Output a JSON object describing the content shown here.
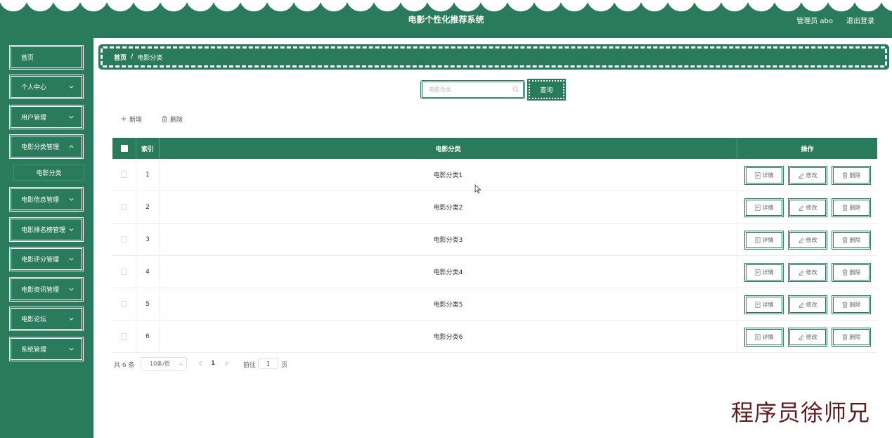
{
  "header": {
    "title": "电影个性化推荐系统",
    "user": "管理员 abo",
    "logout": "退出登录"
  },
  "sidebar": {
    "items": [
      {
        "label": "首页",
        "has_arrow": false
      },
      {
        "label": "个人中心",
        "has_arrow": true
      },
      {
        "label": "用户管理",
        "has_arrow": true
      },
      {
        "label": "电影分类管理",
        "has_arrow": true
      },
      {
        "label": "电影信息管理",
        "has_arrow": true
      },
      {
        "label": "电影排名榜管理",
        "has_arrow": true
      },
      {
        "label": "电影评分管理",
        "has_arrow": true
      },
      {
        "label": "电影资讯管理",
        "has_arrow": true
      },
      {
        "label": "电影论坛",
        "has_arrow": true
      },
      {
        "label": "系统管理",
        "has_arrow": true
      }
    ],
    "sub_item": "电影分类"
  },
  "breadcrumb": {
    "home": "首页",
    "separator": "/",
    "current": "电影分类"
  },
  "search": {
    "placeholder": "电影分类",
    "button": "查询"
  },
  "toolbar": {
    "add": "新增",
    "delete": "删除"
  },
  "table": {
    "headers": {
      "index": "索引",
      "name": "电影分类",
      "ops": "操作"
    },
    "rows": [
      {
        "index": "1",
        "name": "电影分类1"
      },
      {
        "index": "2",
        "name": "电影分类2"
      },
      {
        "index": "3",
        "name": "电影分类3"
      },
      {
        "index": "4",
        "name": "电影分类4"
      },
      {
        "index": "5",
        "name": "电影分类5"
      },
      {
        "index": "6",
        "name": "电影分类6"
      }
    ],
    "ops": {
      "detail": "详情",
      "edit": "修改",
      "delete": "删除"
    }
  },
  "pagination": {
    "total": "共 6 条",
    "page_size": "10条/页",
    "current_page": "1",
    "goto_label": "前往",
    "goto_value": "1",
    "page_suffix": "页"
  },
  "watermark": "程序员徐师兄",
  "colors": {
    "primary": "#2a7a5c",
    "white": "#ffffff"
  }
}
